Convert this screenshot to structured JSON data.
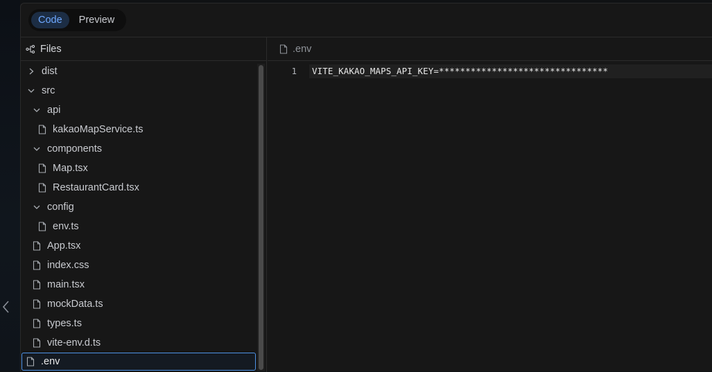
{
  "view_toggle": {
    "code_label": "Code",
    "preview_label": "Preview",
    "active": "Code"
  },
  "sidebar": {
    "title": "Files",
    "tree": [
      {
        "label": "dist",
        "type": "folder",
        "expanded": false,
        "depth": 0
      },
      {
        "label": "src",
        "type": "folder",
        "expanded": true,
        "depth": 0
      },
      {
        "label": "api",
        "type": "folder",
        "expanded": true,
        "depth": 1
      },
      {
        "label": "kakaoMapService.ts",
        "type": "file",
        "depth": 2
      },
      {
        "label": "components",
        "type": "folder",
        "expanded": true,
        "depth": 1
      },
      {
        "label": "Map.tsx",
        "type": "file",
        "depth": 2
      },
      {
        "label": "RestaurantCard.tsx",
        "type": "file",
        "depth": 2
      },
      {
        "label": "config",
        "type": "folder",
        "expanded": true,
        "depth": 1
      },
      {
        "label": "env.ts",
        "type": "file",
        "depth": 2
      },
      {
        "label": "App.tsx",
        "type": "file",
        "depth": 1
      },
      {
        "label": "index.css",
        "type": "file",
        "depth": 1
      },
      {
        "label": "main.tsx",
        "type": "file",
        "depth": 1
      },
      {
        "label": "mockData.ts",
        "type": "file",
        "depth": 1
      },
      {
        "label": "types.ts",
        "type": "file",
        "depth": 1
      },
      {
        "label": "vite-env.d.ts",
        "type": "file",
        "depth": 1
      },
      {
        "label": ".env",
        "type": "file",
        "depth": 0,
        "selected": true
      }
    ]
  },
  "editor": {
    "tab_label": ".env",
    "lines": [
      {
        "number": "1",
        "text": "VITE_KAKAO_MAPS_API_KEY=********************************"
      }
    ]
  },
  "icons": {
    "files": "tree-structure-icon",
    "folder_collapsed": "chevron-right-icon",
    "folder_expanded": "chevron-down-icon",
    "file": "file-icon",
    "collapse": "chevron-left-icon"
  },
  "colors": {
    "accent": "#6ea8ff",
    "selection_border": "#4e94e8",
    "panel_bg": "#171717"
  }
}
